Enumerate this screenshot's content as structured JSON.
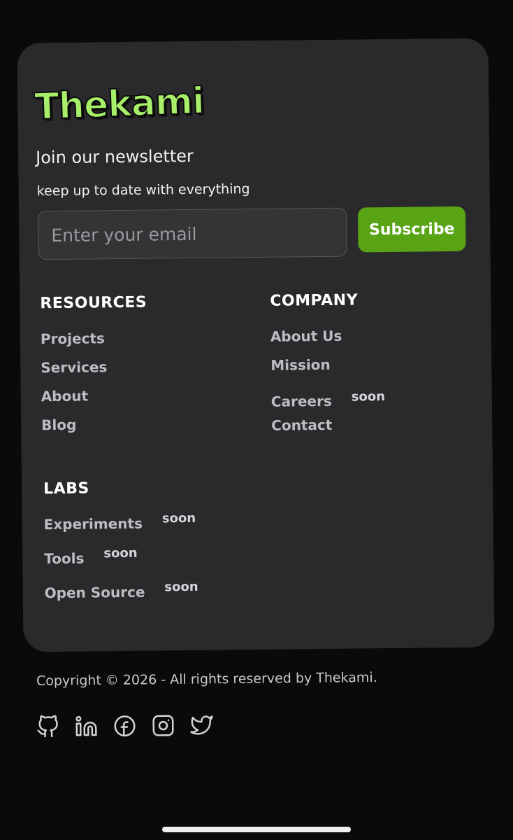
{
  "brand": {
    "name": "Thekami",
    "color": "#a8ef69"
  },
  "newsletter": {
    "title": "Join our newsletter",
    "subtitle": "keep up to date with everything",
    "email_placeholder": "Enter your email",
    "subscribe_label": "Subscribe",
    "subscribe_color": "#58a414"
  },
  "resources": {
    "heading": "RESOURCES",
    "items": [
      {
        "label": "Projects"
      },
      {
        "label": "Services"
      },
      {
        "label": "About"
      },
      {
        "label": "Blog"
      }
    ]
  },
  "company": {
    "heading": "COMPANY",
    "items": [
      {
        "label": "About Us"
      },
      {
        "label": "Mission"
      },
      {
        "label": "Careers",
        "badge": "soon"
      },
      {
        "label": "Contact"
      }
    ]
  },
  "labs": {
    "heading": "LABS",
    "items": [
      {
        "label": "Experiments",
        "badge": "soon"
      },
      {
        "label": "Tools",
        "badge": "soon"
      },
      {
        "label": "Open Source",
        "badge": "soon"
      }
    ]
  },
  "footer": {
    "copyright": "Copyright © 2026 - All rights reserved by Thekami.",
    "socials": [
      "github-icon",
      "linkedin-icon",
      "facebook-icon",
      "instagram-icon",
      "twitter-icon"
    ]
  }
}
